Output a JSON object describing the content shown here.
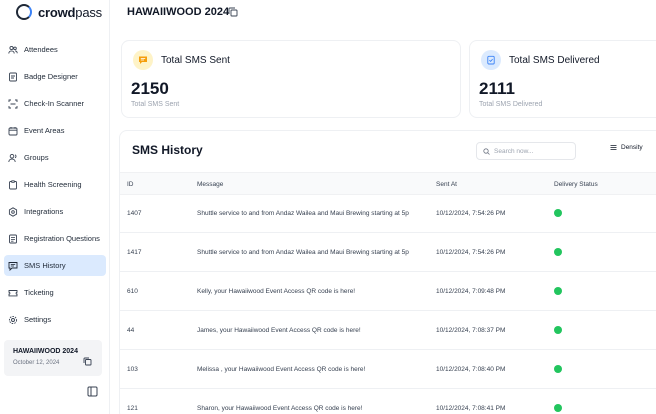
{
  "app": {
    "brand_bold": "crowd",
    "brand_regular": "pass"
  },
  "sidebar": {
    "items": [
      {
        "label": "Attendees",
        "icon": "users-icon"
      },
      {
        "label": "Badge Designer",
        "icon": "badge-icon"
      },
      {
        "label": "Check-In Scanner",
        "icon": "scan-icon"
      },
      {
        "label": "Event Areas",
        "icon": "calendar-icon"
      },
      {
        "label": "Groups",
        "icon": "group-icon"
      },
      {
        "label": "Health Screening",
        "icon": "clipboard-icon"
      },
      {
        "label": "Integrations",
        "icon": "gear-icon"
      },
      {
        "label": "Registration Questions",
        "icon": "form-icon"
      },
      {
        "label": "SMS History",
        "icon": "message-icon",
        "active": true
      },
      {
        "label": "Ticketing",
        "icon": "ticket-icon"
      },
      {
        "label": "Settings",
        "icon": "settings-icon"
      }
    ],
    "event_card": {
      "name": "HAWAIIWOOD 2024",
      "date": "October 12, 2024"
    }
  },
  "header": {
    "title": "HAWAIIWOOD 2024"
  },
  "stats": [
    {
      "title": "Total SMS Sent",
      "value": "2150",
      "label": "Total SMS Sent",
      "icon": "chat-icon",
      "icon_color": "#f59e0b",
      "icon_bg": "#fef3c7"
    },
    {
      "title": "Total SMS Delivered",
      "value": "2111",
      "label": "Total SMS Delivered",
      "icon": "delivered-icon",
      "icon_color": "#3b82f6",
      "icon_bg": "#dbeafe"
    }
  ],
  "history": {
    "title": "SMS History",
    "search_placeholder": "Search now...",
    "density_label": "Density",
    "columns": [
      "ID",
      "Message",
      "Sent At",
      "Delivery Status"
    ],
    "status_color": "#22c55e",
    "rows": [
      {
        "id": "1407",
        "message": "Shuttle service to and from Andaz Wailea and Maui Brewing starting at 5p",
        "sent_at": "10/12/2024, 7:54:26 PM",
        "status": "delivered"
      },
      {
        "id": "1417",
        "message": "Shuttle service to and from Andaz Wailea and Maui Brewing starting at 5p",
        "sent_at": "10/12/2024, 7:54:26 PM",
        "status": "delivered"
      },
      {
        "id": "610",
        "message": "Kelly, your Hawaiiwood Event Access QR code is here!",
        "sent_at": "10/12/2024, 7:09:48 PM",
        "status": "delivered"
      },
      {
        "id": "44",
        "message": "James, your Hawaiiwood Event Access QR code is here!",
        "sent_at": "10/12/2024, 7:08:37 PM",
        "status": "delivered"
      },
      {
        "id": "103",
        "message": "Melissa , your Hawaiiwood Event Access QR code is here!",
        "sent_at": "10/12/2024, 7:08:40 PM",
        "status": "delivered"
      },
      {
        "id": "121",
        "message": "Sharon, your Hawaiiwood Event Access QR code is here!",
        "sent_at": "10/12/2024, 7:08:41 PM",
        "status": "delivered"
      }
    ]
  }
}
